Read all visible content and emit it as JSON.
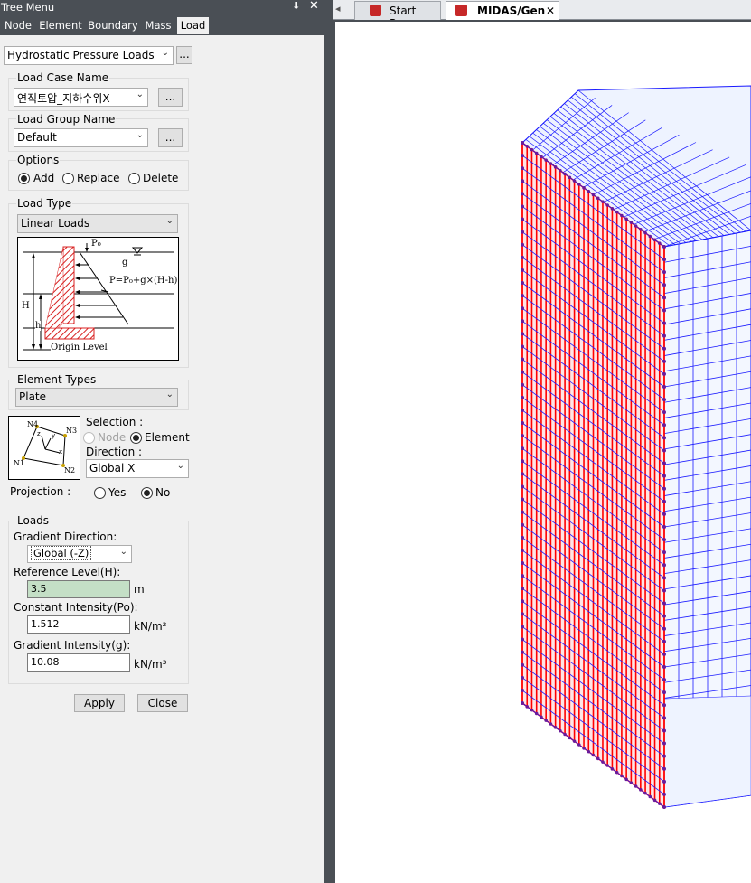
{
  "panel": {
    "title": "Tree Menu",
    "pin_glyph": "⬇",
    "close_glyph": "✕",
    "tabs": [
      "Node",
      "Element",
      "Boundary",
      "Mass",
      "Load"
    ],
    "active_tab": "Load",
    "load_function": "Hydrostatic Pressure Loads",
    "more_label": "...",
    "load_case": {
      "label": "Load Case Name",
      "value": "연직토압_지하수위X"
    },
    "load_group": {
      "label": "Load Group Name",
      "value": "Default"
    },
    "options": {
      "label": "Options",
      "items": [
        "Add",
        "Replace",
        "Delete"
      ],
      "selected": "Add"
    },
    "load_type": {
      "label": "Load Type",
      "value": "Linear Loads",
      "diagram": {
        "p0": "P₀",
        "g": "g",
        "formula": "P=P₀+g×(H-h)",
        "H": "H",
        "h": "h",
        "origin": "Origin Level"
      }
    },
    "element_types": {
      "label": "Element Types",
      "value": "Plate"
    },
    "plate_icon": {
      "n1": "N1",
      "n2": "N2",
      "n3": "N3",
      "n4": "N4",
      "x": "x",
      "y": "y",
      "z": "z"
    },
    "selection": {
      "label": "Selection :",
      "items": [
        "Node",
        "Element"
      ],
      "selected": "Element",
      "disabled": "Node"
    },
    "direction": {
      "label": "Direction :",
      "value": "Global X"
    },
    "projection": {
      "label": "Projection :",
      "items": [
        "Yes",
        "No"
      ],
      "selected": "No"
    },
    "loads": {
      "label": "Loads",
      "gradient_direction_label": "Gradient Direction:",
      "gradient_direction": "Global (-Z)",
      "reference_level_label": "Reference Level(H):",
      "reference_level": "3.5",
      "reference_unit": "m",
      "constant_intensity_label": "Constant Intensity(Po):",
      "constant_intensity": "1.512",
      "constant_unit": "kN/m²",
      "gradient_intensity_label": "Gradient Intensity(g):",
      "gradient_intensity": "10.08",
      "gradient_unit": "kN/m³"
    },
    "apply_label": "Apply",
    "close_label": "Close"
  },
  "document_tabs": {
    "scroll_glyph": "◂",
    "tabs": [
      {
        "label": "Start Page"
      },
      {
        "label": "MIDAS/Gen",
        "active": true
      }
    ],
    "close_glyph": "✕"
  },
  "colors": {
    "panel_bg": "#f0f0f0",
    "dark_chrome": "#4a4f55",
    "mesh": "#1a1aff",
    "loaded_face": "#ff0000",
    "nodes": "#6a1b9a",
    "field_highlight": "#c4dfc6"
  }
}
